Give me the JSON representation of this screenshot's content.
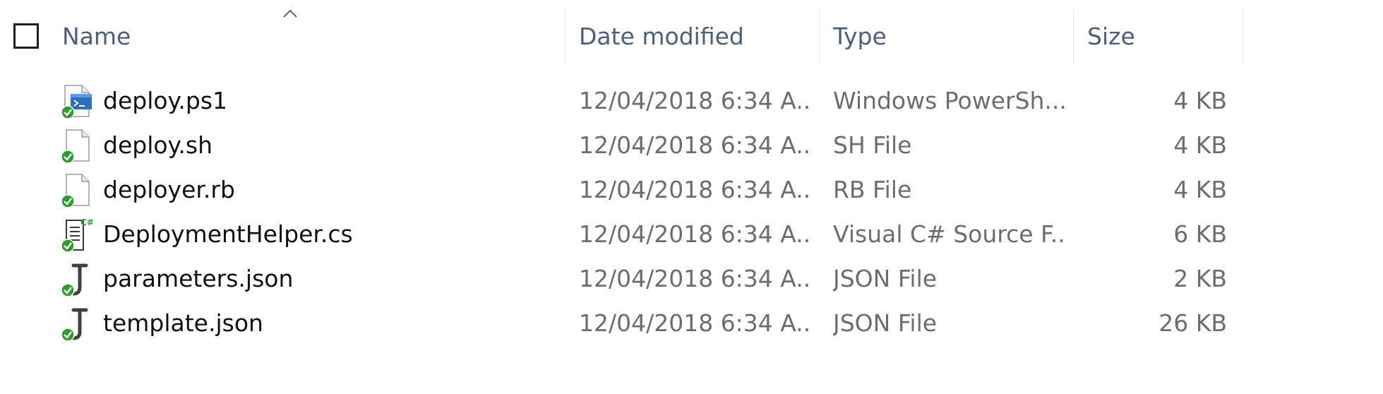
{
  "header": {
    "name": "Name",
    "date_modified": "Date modified",
    "type": "Type",
    "size": "Size",
    "sort_icon": "chevron-up-icon"
  },
  "files": [
    {
      "name": "deploy.ps1",
      "date": "12/04/2018 6:34 A...",
      "type": "Windows PowerSh...",
      "size": "4 KB",
      "icon": "powershell-file-icon",
      "status": "synced-check-icon"
    },
    {
      "name": "deploy.sh",
      "date": "12/04/2018 6:34 A...",
      "type": "SH File",
      "size": "4 KB",
      "icon": "generic-file-icon",
      "status": "synced-check-icon"
    },
    {
      "name": "deployer.rb",
      "date": "12/04/2018 6:34 A...",
      "type": "RB File",
      "size": "4 KB",
      "icon": "generic-file-icon",
      "status": "synced-check-icon"
    },
    {
      "name": "DeploymentHelper.cs",
      "date": "12/04/2018 6:34 A...",
      "type": "Visual C# Source F...",
      "size": "6 KB",
      "icon": "csharp-file-icon",
      "status": "synced-check-icon"
    },
    {
      "name": "parameters.json",
      "date": "12/04/2018 6:34 A...",
      "type": "JSON File",
      "size": "2 KB",
      "icon": "json-file-icon",
      "status": "synced-check-icon"
    },
    {
      "name": "template.json",
      "date": "12/04/2018 6:34 A...",
      "type": "JSON File",
      "size": "26 KB",
      "icon": "json-file-icon",
      "status": "synced-check-icon"
    }
  ],
  "colors": {
    "header_text": "#4c607a",
    "name_text": "#111111",
    "detail_text": "#6d6d6d",
    "synced_green": "#2e9c2e"
  }
}
